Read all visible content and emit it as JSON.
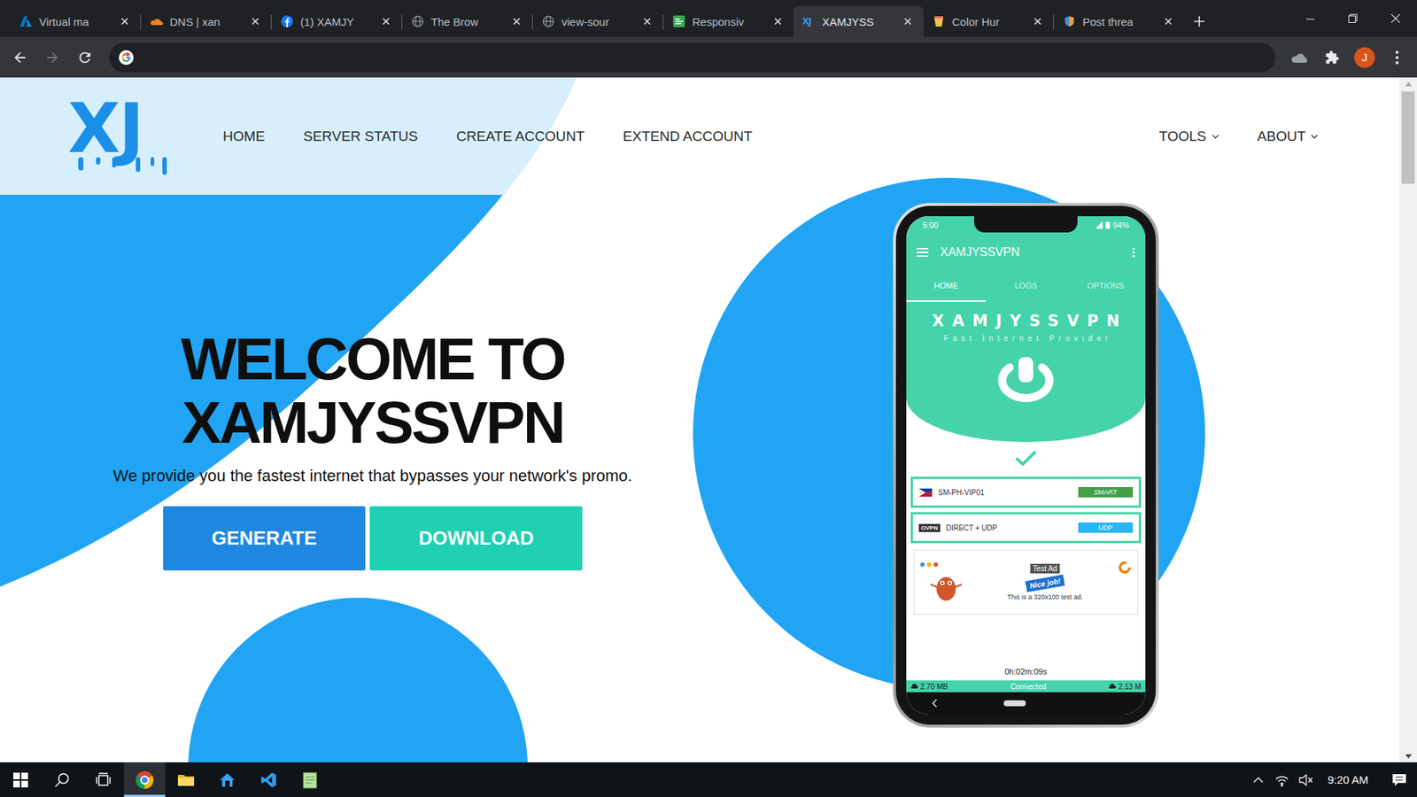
{
  "browser": {
    "tabs": [
      {
        "label": "Virtual ma",
        "kind": "azure",
        "selected": false
      },
      {
        "label": "DNS | xan",
        "kind": "cloudflare",
        "selected": false
      },
      {
        "label": "(1) XAMJY",
        "kind": "facebook",
        "selected": false
      },
      {
        "label": "The Brow",
        "kind": "globe",
        "selected": false
      },
      {
        "label": "view-sour",
        "kind": "globe",
        "selected": false
      },
      {
        "label": "Responsiv",
        "kind": "sheet",
        "selected": false
      },
      {
        "label": "XAMJYSS",
        "kind": "xj",
        "icon_text": "XJ",
        "selected": true
      },
      {
        "label": "Color Hur",
        "kind": "colorhunt",
        "selected": false
      },
      {
        "label": "Post threa",
        "kind": "shield",
        "selected": false
      }
    ],
    "nav_buttons": [
      {
        "kind": "back",
        "disabled": false
      },
      {
        "kind": "forward",
        "disabled": true
      },
      {
        "kind": "reload",
        "disabled": false
      }
    ],
    "address": {
      "value": ""
    },
    "profile": {
      "initial": "J"
    }
  },
  "page": {
    "logo": "XJ",
    "nav": [
      {
        "label": "HOME"
      },
      {
        "label": "SERVER STATUS"
      },
      {
        "label": "CREATE ACCOUNT"
      },
      {
        "label": "EXTEND ACCOUNT"
      }
    ],
    "nav_right": [
      {
        "label": "TOOLS",
        "expanded": false
      },
      {
        "label": "ABOUT",
        "expanded": false
      }
    ],
    "hero": {
      "title": [
        "WELCOME TO",
        "XAMJYSSVPN"
      ],
      "subtitle": "We provide you the fastest internet that bypasses your network's promo.",
      "buttons": [
        {
          "label": "GENERATE",
          "color": "#1e88e0"
        },
        {
          "label": "DOWNLOAD",
          "color": "#1fd0b2"
        }
      ]
    },
    "phone": {
      "time": "5:00",
      "battery": "94%",
      "app_title": "XAMJYSSVPN",
      "tabs": [
        {
          "label": "HOME",
          "selected": true
        },
        {
          "label": "LOGS",
          "selected": false
        },
        {
          "label": "OPTIONS",
          "selected": false
        }
      ],
      "brand": "XAMJYSSVPN",
      "tagline": "Fast Internet Provider",
      "connected": true,
      "rows": [
        {
          "kind": "server",
          "label": "SM-PH-VIP01",
          "badge": "SMART",
          "color": "#43a047"
        },
        {
          "kind": "protocol",
          "icon_text": "OVPN",
          "label": "DIRECT + UDP",
          "badge": "UDP",
          "color": "#29b6f6"
        }
      ],
      "ad": {
        "tag": "Test Ad",
        "bubble": "Nice job!",
        "text": "This is a 320x100 test ad."
      },
      "timer": "0h:02m:09s",
      "status": "Connected",
      "download": "2.70 MB",
      "upload": "2.13 M"
    }
  },
  "scrollbar": {
    "level": 0.14
  },
  "taskbar": {
    "items": [
      {
        "kind": "start",
        "selected": false
      },
      {
        "kind": "search",
        "selected": false
      },
      {
        "kind": "taskview",
        "selected": false
      },
      {
        "kind": "chrome",
        "selected": true
      },
      {
        "kind": "explorer",
        "selected": false
      },
      {
        "kind": "studio",
        "selected": false
      },
      {
        "kind": "vscode",
        "selected": false
      },
      {
        "kind": "notepad",
        "selected": false
      }
    ],
    "tray": {
      "muted": true
    },
    "clock": "9:20 AM"
  }
}
